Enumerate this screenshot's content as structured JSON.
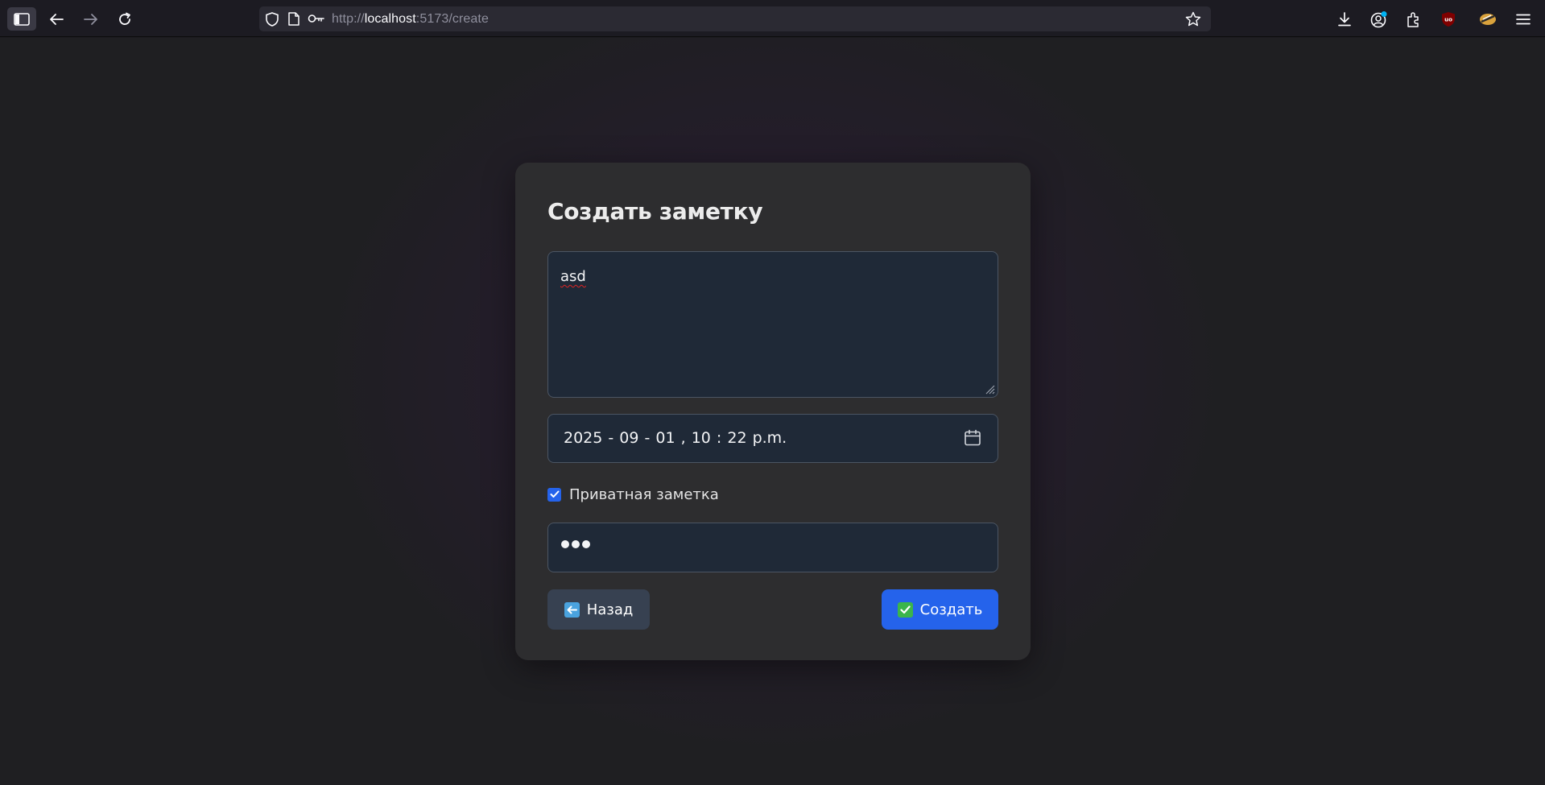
{
  "browser": {
    "url_scheme": "http://",
    "url_host": "localhost",
    "url_path": ":5173/create",
    "icons": [
      "sidebar-icon",
      "back-arrow-icon",
      "forward-arrow-icon",
      "reload-icon",
      "shield-icon",
      "page-icon",
      "key-icon",
      "star-icon",
      "download-icon",
      "account-icon",
      "extensions-icon",
      "ublock-icon",
      "extension-badge-icon",
      "menu-icon"
    ]
  },
  "form": {
    "title": "Создать заметку",
    "note_text": "asd",
    "datetime": "2025 - 09 - 01 ,  10 : 22   p.m.",
    "private_checked": true,
    "private_label": "Приватная заметка",
    "password_dot_count": 3,
    "back_label": "Назад",
    "back_emoji": "back-arrow-emoji",
    "create_label": "Создать",
    "create_emoji": "check-mark-emoji"
  },
  "colors": {
    "accent": "#2563eb",
    "back_button": "#374151",
    "card": "#2d2d2f",
    "input_bg": "#1f2937",
    "glow": "#3e1c52"
  }
}
